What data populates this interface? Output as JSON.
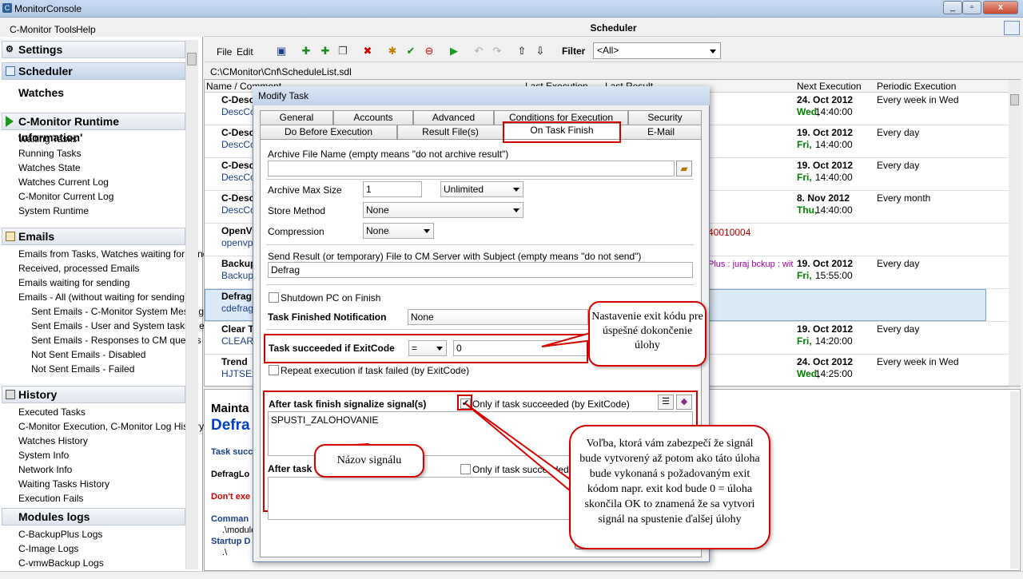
{
  "window": {
    "title": "MonitorConsole",
    "min": "_",
    "max": "▫",
    "close": "x"
  },
  "menu": {
    "tools": "C-Monitor Tools",
    "help": "Help"
  },
  "sidebar": {
    "settings": "Settings",
    "scheduler": "Scheduler",
    "watches": "Watches",
    "runtime": "C-Monitor Runtime Information'",
    "runtime_items": [
      "Waiting Tasks",
      "Running Tasks",
      "Watches State",
      "Watches Current Log",
      "C-Monitor Current Log",
      "System Runtime"
    ],
    "emails": "Emails",
    "email_items": [
      "Emails from Tasks, Watches waiting for send",
      "Received, processed Emails",
      "Emails waiting for sending",
      "Emails - All (without waiting for sending)"
    ],
    "email_sub": [
      "Sent Emails - C-Monitor System Message",
      "Sent Emails - User and System tasks Res",
      "Sent Emails - Responses to CM queries",
      "Not Sent Emails - Disabled",
      "Not Sent Emails - Failed"
    ],
    "history": "History",
    "history_items": [
      "Executed Tasks",
      "C-Monitor Execution, C-Monitor Log History",
      "Watches History",
      "System Info",
      "Network Info",
      "Waiting Tasks History",
      "Execution Fails"
    ],
    "modules": "Modules logs",
    "module_items": [
      "C-BackupPlus Logs",
      "C-Image Logs",
      "C-vmwBackup Logs"
    ]
  },
  "scheduler": {
    "title": "Scheduler",
    "file": "File",
    "edit": "Edit",
    "filter_label": "Filter",
    "filter_value": "<All>",
    "path": "C:\\CMonitor\\Cnf\\ScheduleList.sdl",
    "columns": {
      "name": "Name / Comment",
      "last_exec": "Last Execution",
      "last_result": "Last Result",
      "next": "Next Execution",
      "periodic": "Periodic Execution"
    },
    "rows": [
      {
        "name": "C-Desc",
        "comment": "DescCo",
        "next_date": "24. Oct 2012",
        "next_day": "Wed,",
        "next_time": "14:40:00",
        "periodic": "Every week in Wed"
      },
      {
        "name": "C-Desc",
        "comment": "DescCo",
        "next_date": "19. Oct 2012",
        "next_day": "Fri,",
        "next_time": "14:40:00",
        "periodic": "Every day"
      },
      {
        "name": "C-Desc",
        "comment": "DescCo",
        "next_date": "19. Oct 2012",
        "next_day": "Fri,",
        "next_time": "14:40:00",
        "periodic": "Every day"
      },
      {
        "name": "C-Desc",
        "comment": "DescCo",
        "next_date": "8. Nov 2012",
        "next_day": "Thu,",
        "next_time": "14:40:00",
        "periodic": "Every month"
      },
      {
        "name": "OpenV",
        "comment": "openvp",
        "extra": "40010004",
        "next_date": "",
        "next_day": "",
        "next_time": "",
        "periodic": ""
      },
      {
        "name": "Backup",
        "comment": "Backup",
        "extra": "Plus : juraj bckup : wit",
        "next_date": "19. Oct 2012",
        "next_day": "Fri,",
        "next_time": "15:55:00",
        "periodic": "Every day"
      },
      {
        "name": "Defrag",
        "comment": "cdefrag",
        "next_date": "",
        "next_day": "",
        "next_time": "",
        "periodic": ""
      },
      {
        "name": "Clear T",
        "comment": "CLEARD",
        "next_date": "19. Oct 2012",
        "next_day": "Fri,",
        "next_time": "14:20:00",
        "periodic": "Every day"
      },
      {
        "name": "Trend",
        "comment": "HJTSEx",
        "next_date": "24. Oct 2012",
        "next_day": "Wed,",
        "next_time": "14:25:00",
        "periodic": "Every week in Wed"
      }
    ]
  },
  "bottom": {
    "maint": "Mainta",
    "defrag": "Defra",
    "task_succ": "Task succ",
    "defraglog": "DefragLo",
    "dont_exec": "Don't exe",
    "command": "Comman",
    "module": ".\\module",
    "startup": "Startup D",
    "dot": ".\\"
  },
  "dialog": {
    "title": "Modify Task",
    "tabs_row1": [
      "General",
      "Accounts",
      "Advanced",
      "Conditions for Execution",
      "Security"
    ],
    "tabs_row2": [
      "Do Before Execution",
      "Result File(s)",
      "On Task Finish",
      "E-Mail"
    ],
    "archive_label": "Archive File Name (empty means \"do not archive result\")",
    "archive_value": "",
    "archive_max_label": "Archive Max Size",
    "archive_max_value": "1",
    "archive_unit": "Unlimited",
    "store_label": "Store Method",
    "store_value": "None",
    "compression_label": "Compression",
    "compression_value": "None",
    "send_label": "Send Result (or temporary) File to CM Server with Subject (empty means \"do not send\")",
    "send_value": "Defrag",
    "shutdown_label": "Shutdown PC on Finish",
    "notification_label": "Task Finished Notification",
    "notification_value": "None",
    "exitcode_label": "Task succeeded if ExitCode",
    "exitcode_op": "=",
    "exitcode_value": "0",
    "repeat_label": "Repeat execution if task failed (by ExitCode)",
    "signal_label": "After task finish signalize signal(s)",
    "only_if_label": "Only if task succeeded (by ExitCode)",
    "signal_value": "SPUSTI_ZALOHOVANIE",
    "after_task_label": "After task",
    "only_if_label2": "Only if task succeeded (by"
  },
  "callouts": {
    "exit": "Nastavenie exit kódu pre úspešné dokončenie úlohy",
    "signal_name": "Názov signálu",
    "option": "Voľba, ktorá vám zabezpečí že signál bude vytvorený až potom ako táto úloha bude vykonaná s požadovaným exit kódom napr. exit kod bude 0 = úloha skončila OK to znamená že sa vytvori signál na spustenie ďalšej úlohy"
  }
}
